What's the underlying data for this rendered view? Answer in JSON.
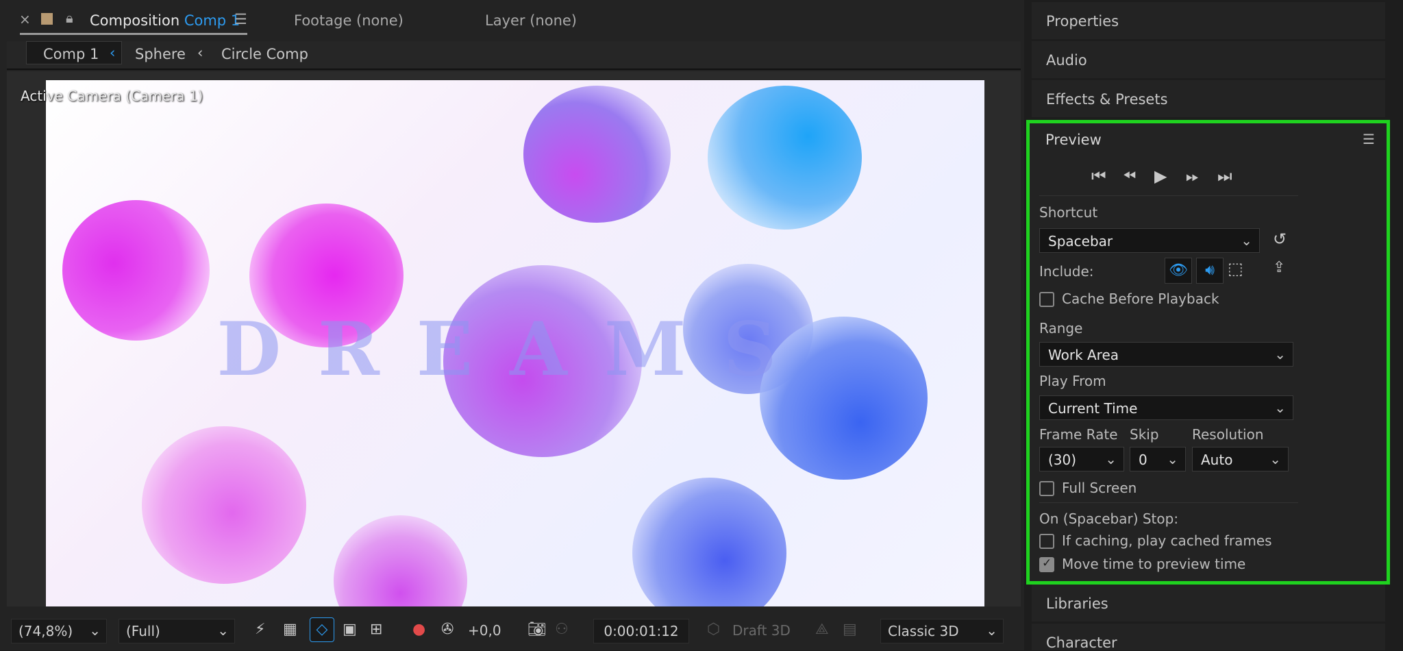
{
  "tabs": {
    "composition_prefix": "Composition",
    "composition_name": "Comp 1",
    "footage": "Footage (none)",
    "layer": "Layer (none)"
  },
  "breadcrumb": [
    "Comp 1",
    "Sphere",
    "Circle Comp"
  ],
  "viewer": {
    "camera_label": "Active Camera (Camera 1)",
    "title_text": "DREAMS"
  },
  "toolbar": {
    "zoom": "(74,8%)",
    "resolution": "(Full)",
    "exposure": "+0,0",
    "timecode": "0:00:01:12",
    "draft3d": "Draft 3D",
    "renderer": "Classic 3D"
  },
  "panels": {
    "properties": "Properties",
    "audio": "Audio",
    "effects": "Effects & Presets",
    "libraries": "Libraries",
    "character": "Character"
  },
  "preview": {
    "title": "Preview",
    "shortcut_label": "Shortcut",
    "shortcut_value": "Spacebar",
    "include_label": "Include:",
    "cache_before_playback": "Cache Before Playback",
    "range_label": "Range",
    "range_value": "Work Area",
    "play_from_label": "Play From",
    "play_from_value": "Current Time",
    "frame_rate_label": "Frame Rate",
    "frame_rate_value": "(30)",
    "skip_label": "Skip",
    "skip_value": "0",
    "resolution_label": "Resolution",
    "resolution_value": "Auto",
    "full_screen": "Full Screen",
    "on_stop_label": "On (Spacebar) Stop:",
    "if_caching": "If caching, play cached frames",
    "move_time": "Move time to preview time",
    "cache_checked": false,
    "full_screen_checked": false,
    "if_caching_checked": false,
    "move_time_checked": true
  },
  "colors": {
    "accent_blue": "#2d9bf0",
    "highlight_green": "#1fd21f"
  }
}
